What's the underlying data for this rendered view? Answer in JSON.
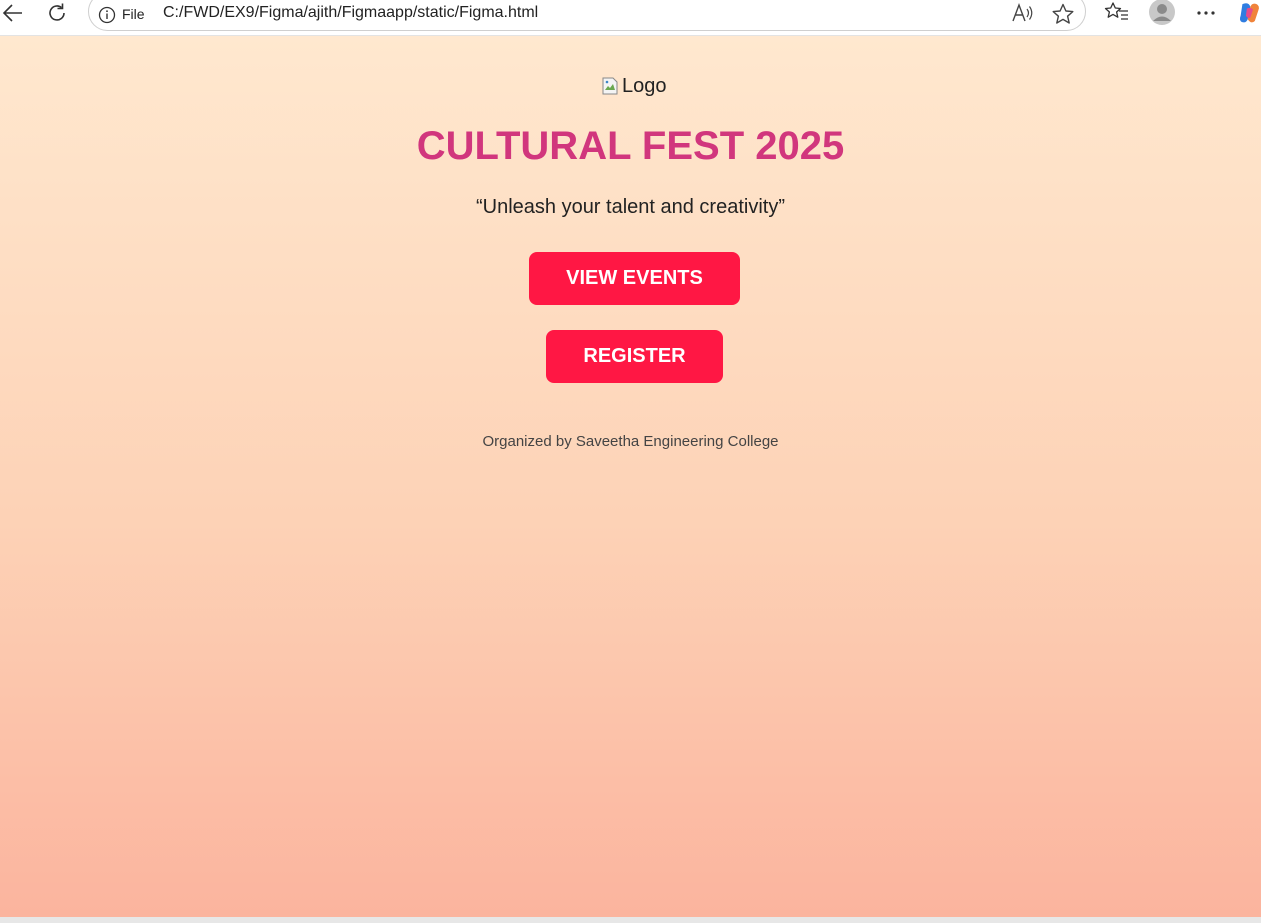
{
  "browser": {
    "file_label": "File",
    "url": "C:/FWD/EX9/Figma/ajith/Figmaapp/static/Figma.html"
  },
  "page": {
    "logo_alt": "Logo",
    "title": "CULTURAL FEST 2025",
    "tagline": "“Unleash your talent and creativity”",
    "view_events_label": "VIEW EVENTS",
    "register_label": "REGISTER",
    "organizer": "Organized by Saveetha Engineering College"
  },
  "colors": {
    "title": "#d1367d",
    "button": "#ff1744",
    "gradient_top": "#ffe8cf",
    "gradient_bottom": "#fbb49e"
  },
  "icons": [
    "back-icon",
    "reload-icon",
    "info-icon",
    "read-aloud-icon",
    "favorite-icon",
    "favorites-list-icon",
    "profile-avatar",
    "more-icon",
    "copilot-icon",
    "broken-image-icon"
  ]
}
